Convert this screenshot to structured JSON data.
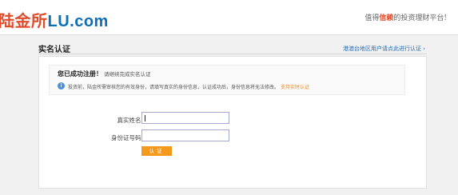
{
  "header": {
    "logo_cn": "陆金所",
    "logo_en": "LU.com",
    "slogan_pre": "值得",
    "slogan_hl": "信赖",
    "slogan_post": "的投资理财平台!"
  },
  "section": {
    "title": "实名认证",
    "region_link": "港澳台地区用户请点此进行认证 ›"
  },
  "notice": {
    "title_bold": "您已成功注册！",
    "title_sub": "请继续完成实名认证",
    "icon": "i",
    "text": "投资前，陆金所需审核您的有效身份，请填写真实的身份信息，认证成功后，身份信息将无法修改。",
    "link": "支持实时认证"
  },
  "form": {
    "name_label": "真实姓名：",
    "name_value": "",
    "id_label": "身份证号码：",
    "id_value": "",
    "submit_label": "认证"
  }
}
